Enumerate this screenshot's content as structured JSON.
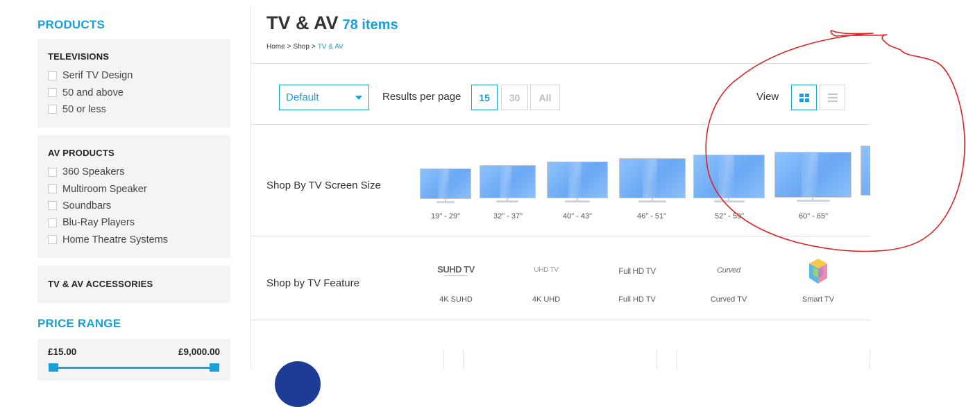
{
  "sidebar": {
    "products_heading": "PRODUCTS",
    "facets": [
      {
        "title": "TELEVISIONS",
        "options": [
          "Serif TV Design",
          "50 and above",
          "50 or less"
        ]
      },
      {
        "title": "AV PRODUCTS",
        "options": [
          "360 Speakers",
          "Multiroom Speaker",
          "Soundbars",
          "Blu-Ray Players",
          "Home Theatre Systems"
        ]
      },
      {
        "title": "TV & AV ACCESSORIES",
        "options": []
      }
    ],
    "price_heading": "PRICE RANGE",
    "price_min": "£15.00",
    "price_max": "£9,000.00"
  },
  "header": {
    "title": "TV & AV",
    "count": "78 items",
    "breadcrumb": [
      "Home",
      ">",
      "Shop",
      ">",
      "TV & AV"
    ]
  },
  "toolbar": {
    "sort_value": "Default",
    "rpp_label": "Results per page",
    "rpp_options": [
      "15",
      "30",
      "All"
    ],
    "rpp_selected": "15",
    "view_label": "View",
    "view_selected": "grid"
  },
  "screen_size": {
    "label": "Shop By TV Screen Size",
    "sizes": [
      "19\" - 29\"",
      "32\" - 37\"",
      "40\" - 43\"",
      "46\" - 51\"",
      "52\" - 59\"",
      "60\" - 65\""
    ]
  },
  "feature": {
    "label": "Shop by TV Feature",
    "logos": [
      "SUHD TV",
      "UHD TV",
      "Full HD TV",
      "Curved",
      ""
    ],
    "items": [
      "4K SUHD",
      "4K UHD",
      "Full HD TV",
      "Curved TV",
      "Smart TV"
    ]
  },
  "colors": {
    "accent": "#1aa0d8",
    "annotation": "#e02020"
  }
}
